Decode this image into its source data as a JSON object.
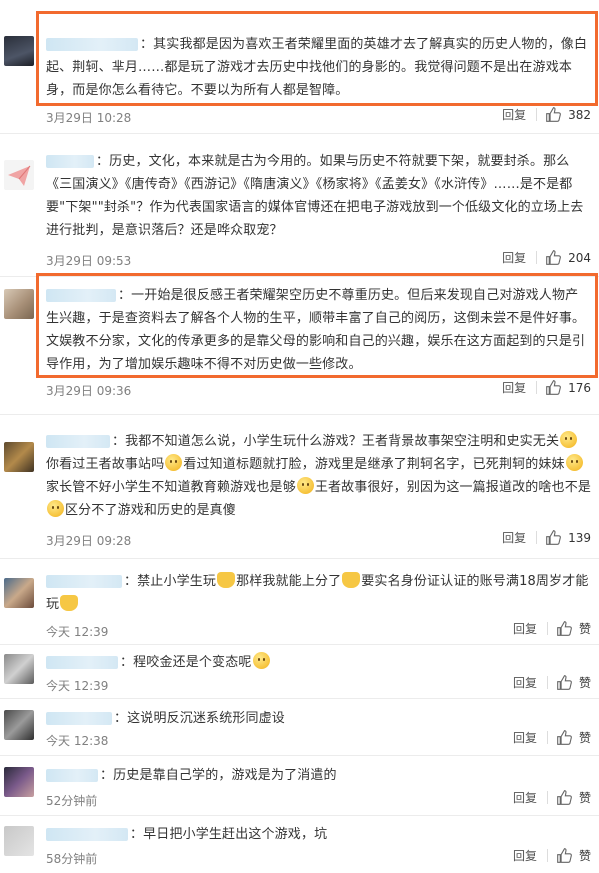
{
  "reply_label": "回复",
  "like_label": "赞",
  "highlight_color": "#f26a2e",
  "comments": [
    {
      "text": "：其实我都是因为喜欢王者荣耀里面的英雄才去了解真实的历史人物的，像白起、荆轲、芈月……都是玩了游戏才去历史中找他们的身影的。我觉得问题不是出在游戏本身，而是你怎么看待它。不要以为所有人都是智障。",
      "time": "3月29日 10:28",
      "likes": "382"
    },
    {
      "text": "：历史，文化，本来就是古为今用的。如果与历史不符就要下架，就要封杀。那么《三国演义》《唐传奇》《西游记》《隋唐演义》《杨家将》《孟姜女》《水浒传》……是不是都要\"下架\"\"封杀\"？作为代表国家语言的媒体官博还在把电子游戏放到一个低级文化的立场上去进行批判，是意识落后？还是哗众取宠？",
      "time": "3月29日 09:53",
      "likes": "204"
    },
    {
      "text": "：一开始是很反感王者荣耀架空历史不尊重历史。但后来发现自己对游戏人物产生兴趣，于是查资料去了解各个人物的生平，顺带丰富了自己的阅历，这倒未尝不是件好事。文娱教不分家，文化的传承更多的是靠父母的影响和自己的兴趣，娱乐在这方面起到的只是引导作用，为了增加娱乐趣味不得不对历史做一些修改。",
      "time": "3月29日 09:36",
      "likes": "176"
    },
    {
      "parts": [
        "：我都不知道怎么说，小学生玩什么游戏？王者背景故事架空注明和史实无关",
        "你看过王者故事站吗",
        "看过知道标题就打脸，游戏里是继承了荆轲名字，已死荆轲的妹妹",
        "家长管不好小学生不知道教育赖游戏也是够",
        "王者故事很好，别因为这一篇报道改的啥也不是",
        "区分不了游戏和历史的是真傻"
      ],
      "time": "3月29日 09:28",
      "likes": "139"
    },
    {
      "parts": [
        "：禁止小学生玩",
        "那样我就能上分了",
        "要实名身份证认证的账号满18周岁才能玩",
        ""
      ],
      "time": "今天 12:39",
      "likes": "赞"
    },
    {
      "parts": [
        "：程咬金还是个变态呢",
        ""
      ],
      "time": "今天 12:39",
      "likes": "赞"
    },
    {
      "text": "：这说明反沉迷系统形同虚设",
      "time": "今天 12:38",
      "likes": "赞"
    },
    {
      "text": "：历史是靠自己学的，游戏是为了消遣的",
      "time": "52分钟前",
      "likes": "赞"
    },
    {
      "text": "：早日把小学生赶出这个游戏，坑",
      "time": "58分钟前",
      "likes": "赞"
    }
  ]
}
